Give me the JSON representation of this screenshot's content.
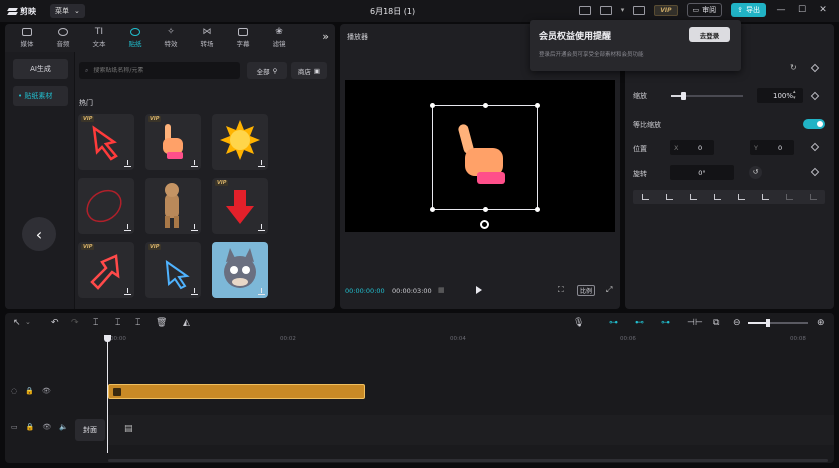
{
  "app": {
    "name": "剪映",
    "menu_label": "菜单",
    "doc_title": "6月18日 (1)",
    "vip_label": "VIP",
    "review_label": "审阅",
    "export_label": "导出"
  },
  "categories": [
    {
      "label": "媒体",
      "icon": "media-icon"
    },
    {
      "label": "音频",
      "icon": "audio-icon"
    },
    {
      "label": "文本",
      "icon": "text-icon"
    },
    {
      "label": "贴纸",
      "icon": "sticker-icon",
      "active": true
    },
    {
      "label": "特效",
      "icon": "effects-icon"
    },
    {
      "label": "转场",
      "icon": "transition-icon"
    },
    {
      "label": "字幕",
      "icon": "subtitle-icon"
    },
    {
      "label": "滤镜",
      "icon": "filter-icon"
    }
  ],
  "sidebar": {
    "ai_label": "AI生成",
    "material_label": "• 贴纸素材"
  },
  "search": {
    "placeholder": "搜索贴纸名称/元素"
  },
  "filter_label": "全部",
  "store_label": "商店",
  "hot_label": "热门",
  "stickers": [
    {
      "name": "neon-red-arrow",
      "vip": true,
      "download": true
    },
    {
      "name": "pointing-hand",
      "vip": true,
      "download": true
    },
    {
      "name": "smiling-sun",
      "vip": false,
      "download": true
    },
    {
      "name": "red-circle-scribble",
      "vip": false,
      "download": true
    },
    {
      "name": "dancing-dog",
      "vip": false,
      "download": true
    },
    {
      "name": "red-down-arrow",
      "vip": true,
      "download": true
    },
    {
      "name": "neon-up-arrow",
      "vip": true,
      "download": true
    },
    {
      "name": "blue-cursor-arrow",
      "vip": true,
      "download": true
    },
    {
      "name": "cartoon-cat",
      "vip": false,
      "download": true
    }
  ],
  "vip_tag": "VIP",
  "player": {
    "title": "播放器",
    "current_time": "00:00:00:00",
    "total_time": "00:00:03:00",
    "ratio_label": "比例"
  },
  "popup": {
    "title": "会员权益使用提醒",
    "description": "登录后开通会员可享受全部素材和会员功能",
    "button": "去登录"
  },
  "props": {
    "scale_label": "缩放",
    "scale_value": "100%",
    "scale_fraction": 0.17,
    "uniform_label": "等比缩放",
    "position_label": "位置",
    "x_label": "X",
    "x_value": "0",
    "y_label": "Y",
    "y_value": "0",
    "rotate_label": "旋转",
    "rotate_value": "0°"
  },
  "timeline": {
    "ruler": [
      "00:00",
      "00:02",
      "00:04",
      "00:06",
      "00:08"
    ],
    "cover_label": "封面",
    "zoom_fraction": 0.33
  }
}
